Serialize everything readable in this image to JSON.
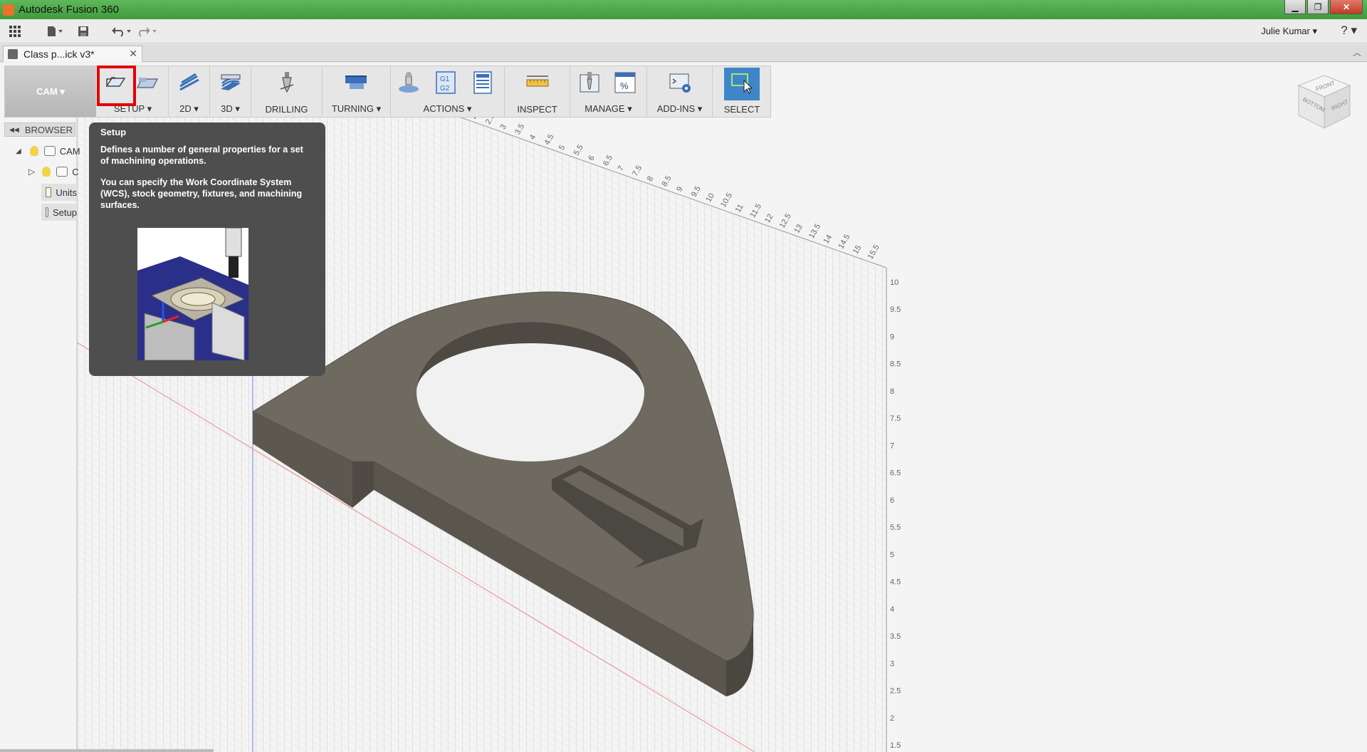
{
  "window": {
    "title": "Autodesk Fusion 360"
  },
  "quick_access": {
    "user": "Julie Kumar ▾",
    "help": "?"
  },
  "document_tab": {
    "label": "Class p...ick v3*",
    "close": "✕"
  },
  "toolbar": {
    "workspace": "CAM ▾",
    "groups": [
      {
        "label": "SETUP ▾"
      },
      {
        "label": "2D ▾"
      },
      {
        "label": "3D ▾"
      },
      {
        "label": "DRILLING"
      },
      {
        "label": "TURNING ▾"
      },
      {
        "label": "ACTIONS ▾"
      },
      {
        "label": "INSPECT"
      },
      {
        "label": "MANAGE ▾"
      },
      {
        "label": "ADD-INS ▾"
      },
      {
        "label": "SELECT"
      }
    ]
  },
  "browser": {
    "header": "BROWSER",
    "items": [
      {
        "label": "CAM"
      },
      {
        "label": "C"
      },
      {
        "label": "Units"
      },
      {
        "label": "Setup"
      }
    ]
  },
  "tooltip": {
    "title": "Setup",
    "para1": "Defines a number of general properties for a set of machining operations.",
    "para2": "You can specify the Work Coordinate System (WCS), stock geometry, fixtures, and machining surfaces."
  },
  "grid_ticks_top": [
    "1",
    "1.5",
    "2",
    "2.5",
    "3",
    "3.5",
    "4",
    "4.5",
    "5",
    "5.5",
    "6",
    "6.5",
    "7",
    "7.5",
    "8",
    "8.5",
    "9",
    "9.5",
    "10",
    "10.5",
    "11",
    "11.5",
    "12",
    "12.5",
    "13",
    "13.5",
    "14",
    "14.5",
    "15",
    "15.5"
  ],
  "grid_ticks_side": [
    "10",
    "9.5",
    "9",
    "8.5",
    "8",
    "7.5",
    "7",
    "6.5",
    "6",
    "5.5",
    "5",
    "4.5",
    "4",
    "3.5",
    "3",
    "2.5",
    "2",
    "1.5"
  ],
  "viewcube": {
    "top": "FRONT",
    "left": "BOTTOM",
    "right": "RIGHT"
  }
}
